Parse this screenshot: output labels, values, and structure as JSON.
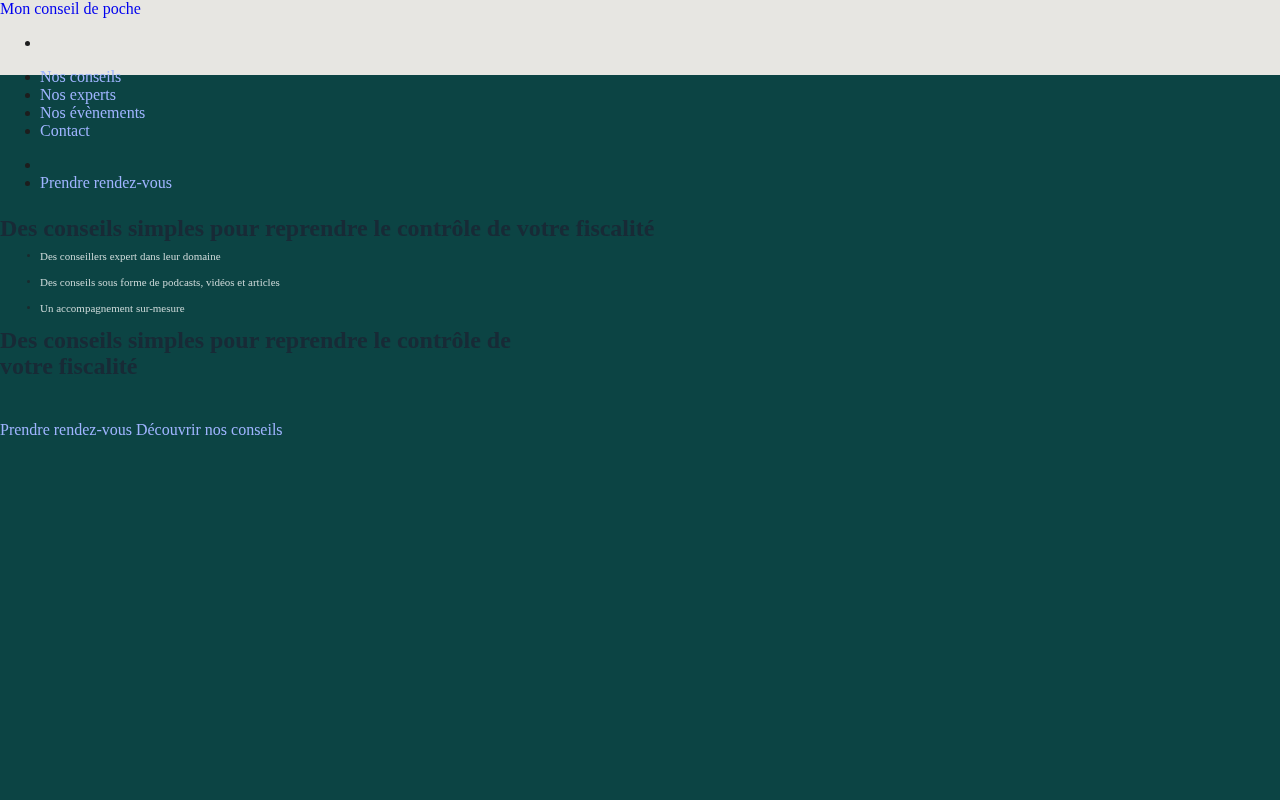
{
  "site_title": "Mon conseil de poche",
  "nav_menu": [
    "Nos conseils",
    "Nos experts",
    "Nos évènements",
    "Contact"
  ],
  "nav_cta": "Prendre rendez-vous",
  "hero": {
    "heading": "Des conseils simples pour reprendre le contrôle de votre fiscalité",
    "features": [
      "Des conseillers expert dans leur domaine",
      "Des conseils sous forme de podcasts, vidéos et articles",
      "Un accompagnement sur-mesure"
    ],
    "heading_2": "Des conseils simples pour reprendre le contrôle de votre fiscalité",
    "buttons": [
      "Prendre rendez-vous",
      "Découvrir nos conseils"
    ]
  }
}
